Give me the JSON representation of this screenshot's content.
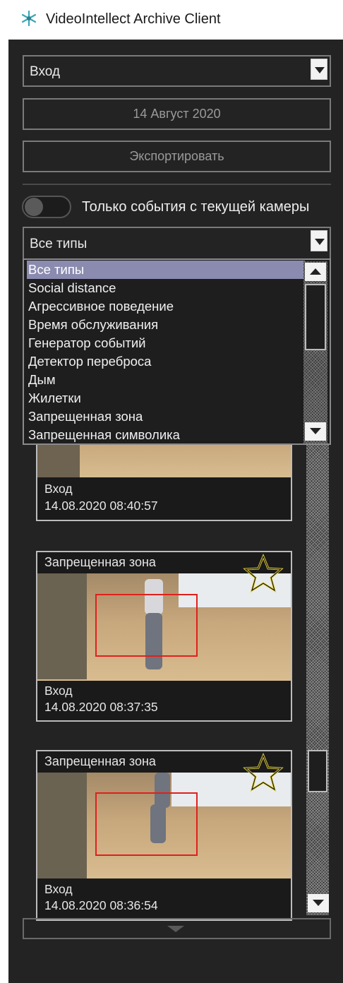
{
  "window": {
    "title": "VideoIntellect Archive Client",
    "icon": "snowflake-icon"
  },
  "filters": {
    "camera": "Вход",
    "date": "14 Август 2020",
    "export_label": "Экспортировать",
    "toggle_label": "Только события с текущей камеры",
    "toggle_on": false,
    "type_selected": "Все типы"
  },
  "type_options": [
    "Все типы",
    "Social distance",
    "Агрессивное поведение",
    "Время обслуживания",
    "Генератор событий",
    "Детектор переброса",
    "Дым",
    "Жилетки",
    "Запрещенная зона",
    "Запрещенная символика"
  ],
  "events": [
    {
      "type": "",
      "camera": "Вход",
      "time": "14.08.2020 08:40:57"
    },
    {
      "type": "Запрещенная зона",
      "camera": "Вход",
      "time": "14.08.2020 08:37:35",
      "starred": true
    },
    {
      "type": "Запрещенная зона",
      "camera": "Вход",
      "time": "14.08.2020 08:36:54",
      "starred": true
    }
  ],
  "colors": {
    "panel": "#232323",
    "selection": "#8b8bb0",
    "detection": "#e0201c",
    "star": "#e8d43a"
  }
}
